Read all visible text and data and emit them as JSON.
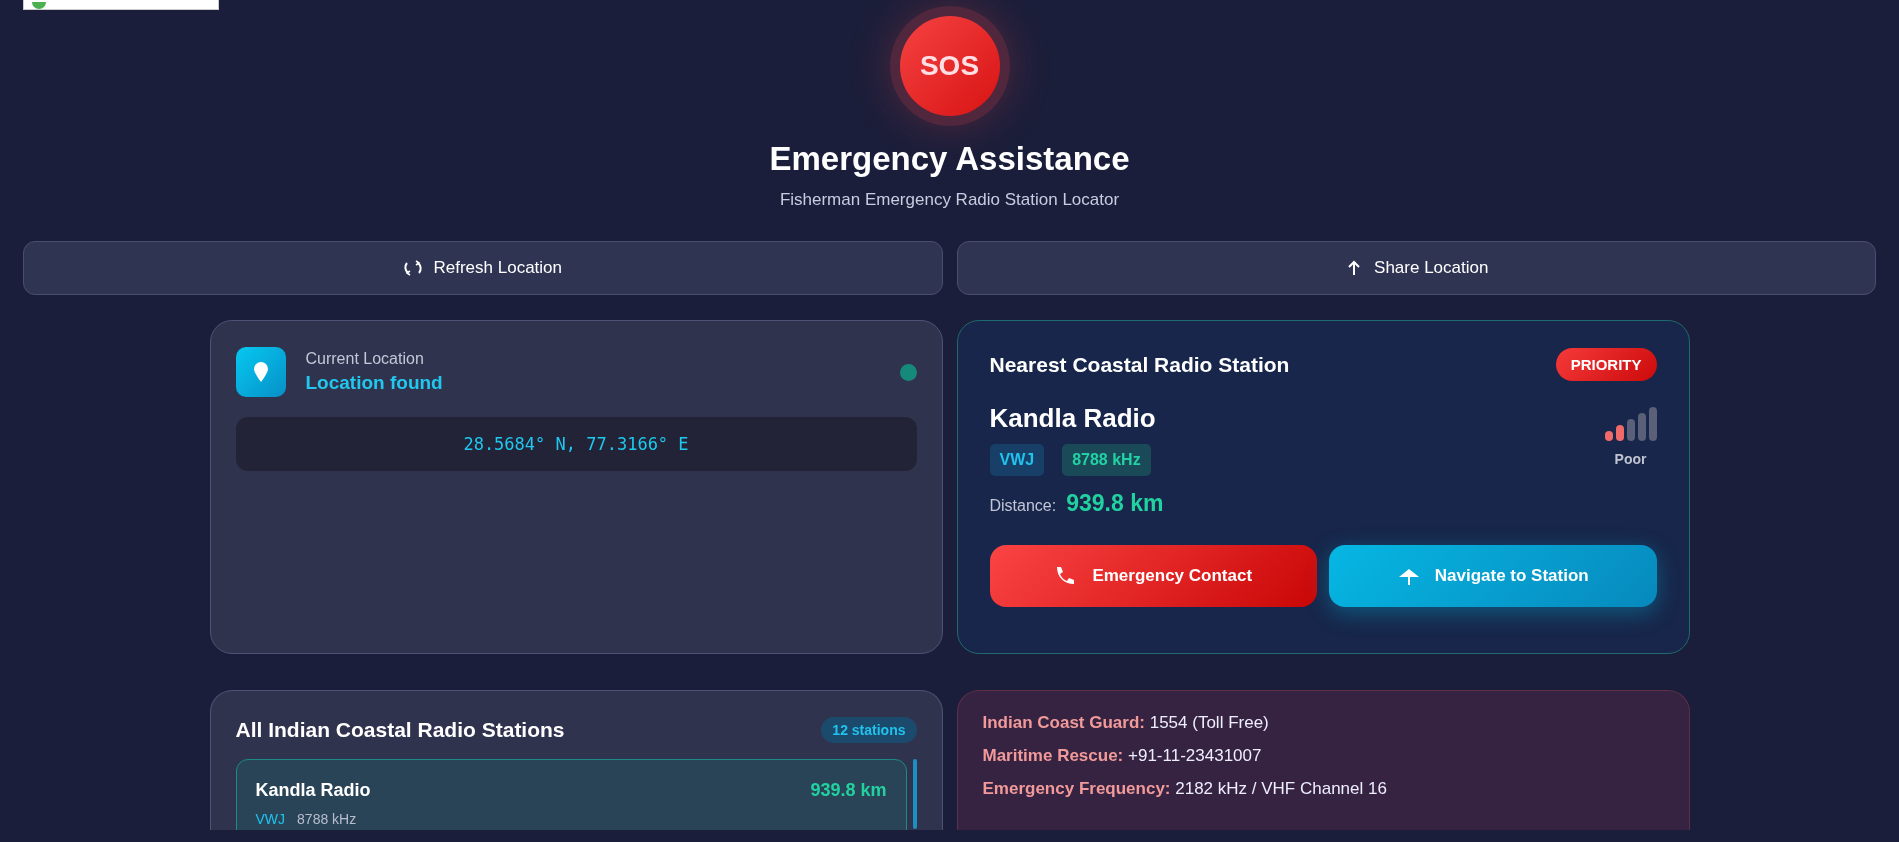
{
  "sos": {
    "label": "SOS"
  },
  "header": {
    "title": "Emergency Assistance",
    "subtitle": "Fisherman Emergency Radio Station Locator"
  },
  "actions": [
    {
      "label": "Refresh Location",
      "kind": "refresh"
    },
    {
      "label": "Share Location",
      "kind": "share"
    }
  ],
  "location_card": {
    "label": "Current Location",
    "status": "Location found",
    "coordinates": "28.5684° N, 77.3166° E"
  },
  "nearest_station": {
    "heading": "Nearest Coastal Radio Station",
    "badge": "PRIORITY",
    "name": "Kandla Radio",
    "call_sign": "VWJ",
    "frequency": "8788 kHz",
    "signal_label": "Poor",
    "distance_label": "Distance:",
    "distance": "939.8 km",
    "buttons": [
      {
        "label": "Emergency Contact",
        "kind": "danger"
      },
      {
        "label": "Navigate to Station",
        "kind": "navigate"
      }
    ]
  },
  "stations_panel": {
    "title": "All Indian Coastal Radio Stations",
    "count": "12 stations",
    "stations": [
      {
        "name": "Kandla Radio",
        "distance": "939.8 km",
        "call_sign": "VWJ",
        "frequency": "8788 kHz",
        "selected": true
      }
    ]
  },
  "contacts": [
    {
      "label": "Indian Coast Guard:",
      "value": "1554 (Toll Free)"
    },
    {
      "label": "Maritime Rescue:",
      "value": "+91-11-23431007"
    },
    {
      "label": "Emergency Frequency:",
      "value": "2182 kHz / VHF Channel 16"
    }
  ]
}
